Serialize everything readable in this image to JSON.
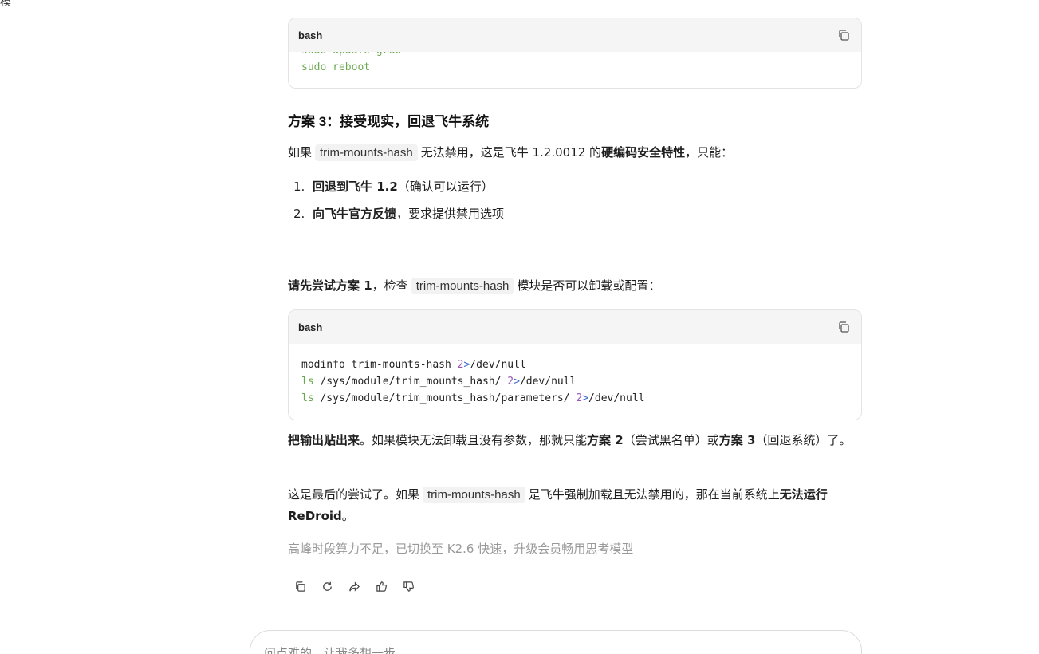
{
  "corner_glyph": "模",
  "code_block_1": {
    "lang": "bash",
    "lines": [
      [
        {
          "t": "sudo update-grub",
          "c": "kw"
        }
      ],
      [
        {
          "t": "sudo reboot",
          "c": "kw"
        }
      ]
    ]
  },
  "section3": {
    "heading": "方案 3：接受现实，回退飞牛系统",
    "para_pre": "如果",
    "para_code": "trim-mounts-hash",
    "para_mid": "无法禁用，这是飞牛 1.2.0012 的",
    "para_bold": "硬编码安全特性",
    "para_post": "，只能：",
    "items": [
      {
        "num": "1.",
        "bold": "回退到飞牛 1.2",
        "rest": "（确认可以运行）"
      },
      {
        "num": "2.",
        "bold": "向飞牛官方反馈",
        "rest": "，要求提供禁用选项"
      }
    ]
  },
  "try_para": {
    "bold": "请先尝试方案 1",
    "mid": "，检查",
    "code": "trim-mounts-hash",
    "post": "模块是否可以卸载或配置："
  },
  "code_block_2": {
    "lang": "bash",
    "lines": [
      [
        {
          "t": "modinfo trim-mounts-hash ",
          "c": ""
        },
        {
          "t": "2",
          "c": "num"
        },
        {
          "t": ">",
          "c": "op"
        },
        {
          "t": "/dev/null",
          "c": ""
        }
      ],
      [
        {
          "t": "ls",
          "c": "kw"
        },
        {
          "t": " /sys/module/trim_mounts_hash/ ",
          "c": ""
        },
        {
          "t": "2",
          "c": "num"
        },
        {
          "t": ">",
          "c": "op"
        },
        {
          "t": "/dev/null",
          "c": ""
        }
      ],
      [
        {
          "t": "ls",
          "c": "kw"
        },
        {
          "t": " /sys/module/trim_mounts_hash/parameters/ ",
          "c": ""
        },
        {
          "t": "2",
          "c": "num"
        },
        {
          "t": ">",
          "c": "op"
        },
        {
          "t": "/dev/null",
          "c": ""
        }
      ]
    ]
  },
  "output_para": {
    "bold1": "把输出贴出来",
    "text1": "。如果模块无法卸载且没有参数，那就只能",
    "bold2": "方案 2",
    "text2": "（尝试黑名单）或",
    "bold3": "方案 3",
    "text3": "（回退系统）了。"
  },
  "final_para": {
    "pre": "这是最后的尝试了。如果",
    "code": "trim-mounts-hash",
    "mid": "是飞牛强制加载且无法禁用的，那在当前系统上",
    "bold": "无法运行 ReDroid",
    "post": "。"
  },
  "note": "高峰时段算力不足，已切换至 K2.6 快速，升级会员畅用思考模型",
  "input": {
    "placeholder": "问点难的，让我多想一步"
  },
  "icons": {
    "copy": "copy-icon",
    "regenerate": "refresh-icon",
    "share": "share-icon",
    "like": "thumbs-up-icon",
    "dislike": "thumbs-down-icon"
  }
}
